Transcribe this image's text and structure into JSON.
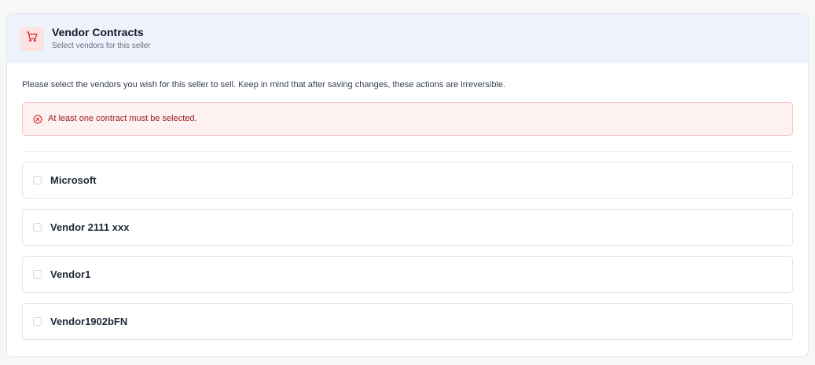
{
  "panel": {
    "title": "Vendor Contracts",
    "subtitle": "Select vendors for this seller",
    "icon": "shopping-cart-icon"
  },
  "intro_text": "Please select the vendors you wish for this seller to sell. Keep in mind that after saving changes, these actions are irreversible.",
  "alert": {
    "icon": "error-circle-x-icon",
    "message": "At least one contract must be selected."
  },
  "vendors": [
    {
      "label": "Microsoft",
      "checked": false
    },
    {
      "label": "Vendor 2111 xxx",
      "checked": false
    },
    {
      "label": "Vendor1",
      "checked": false
    },
    {
      "label": "Vendor1902bFN",
      "checked": false
    }
  ],
  "colors": {
    "header_background": "#eef2fd",
    "icon_tile_background": "#fde2e2",
    "icon_color": "#dc2626",
    "alert_background": "#fdf1f1",
    "alert_border": "#f7c4c4",
    "alert_text": "#9b1c1c"
  }
}
